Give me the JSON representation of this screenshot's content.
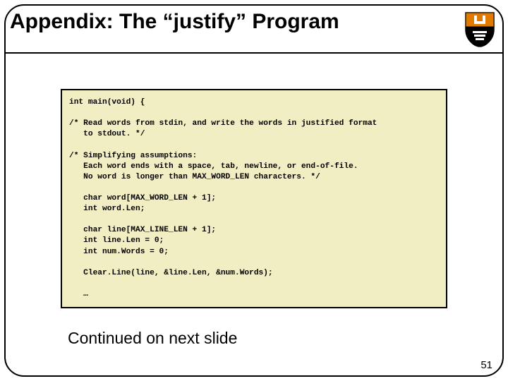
{
  "title": "Appendix: The “justify” Program",
  "code": "int main(void) {\n\n/* Read words from stdin, and write the words in justified format\n   to stdout. */\n\n/* Simplifying assumptions:\n   Each word ends with a space, tab, newline, or end-of-file.\n   No word is longer than MAX_WORD_LEN characters. */\n\n   char word[MAX_WORD_LEN + 1];\n   int word.Len;\n\n   char line[MAX_LINE_LEN + 1];\n   int line.Len = 0;\n   int num.Words = 0;\n\n   Clear.Line(line, &line.Len, &num.Words);\n\n   …",
  "continued": "Continued on next slide",
  "page_number": "51",
  "logo_name": "princeton-shield"
}
